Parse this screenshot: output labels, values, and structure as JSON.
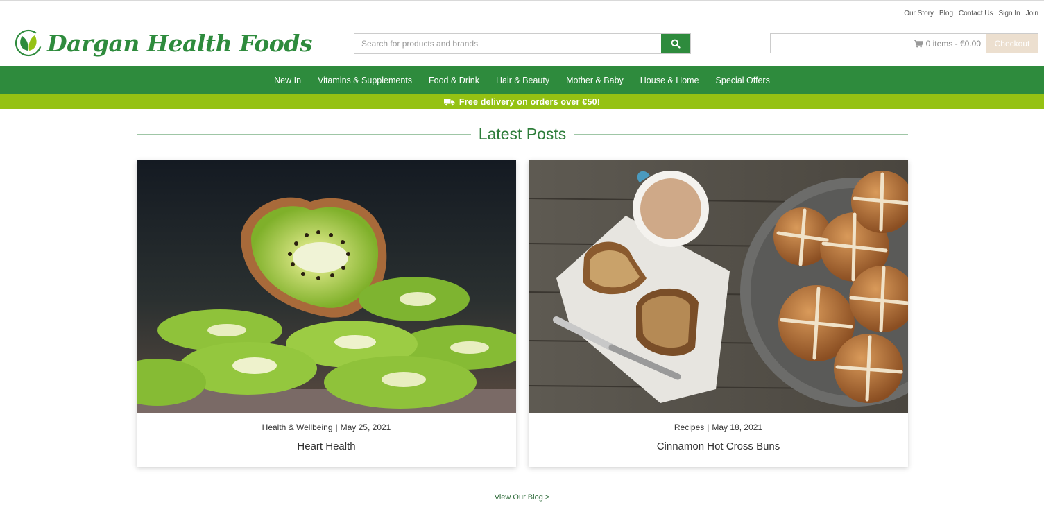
{
  "header": {
    "util_links": [
      "Our Story",
      "Blog",
      "Contact Us",
      "Sign In",
      "Join"
    ],
    "logo_text": "Dargan Health Foods",
    "search": {
      "placeholder": "Search for products and brands",
      "value": ""
    },
    "cart": {
      "summary": "0 items - €0.00",
      "checkout_label": "Checkout"
    }
  },
  "nav": {
    "items": [
      "New In",
      "Vitamins & Supplements",
      "Food & Drink",
      "Hair & Beauty",
      "Mother & Baby",
      "House & Home",
      "Special Offers"
    ]
  },
  "promo": {
    "text": "Free delivery on orders over €50!"
  },
  "latest": {
    "heading": "Latest Posts",
    "posts": [
      {
        "category": "Health & Wellbeing",
        "date": "May 25, 2021",
        "title": "Heart Health"
      },
      {
        "category": "Recipes",
        "date": "May 18, 2021",
        "title": "Cinnamon Hot Cross Buns"
      }
    ],
    "view_blog": "View Our Blog  >"
  },
  "colors": {
    "brand_green": "#2e8b3d",
    "promo_green": "#95c213",
    "checkout_bg": "#ecdfcf"
  }
}
